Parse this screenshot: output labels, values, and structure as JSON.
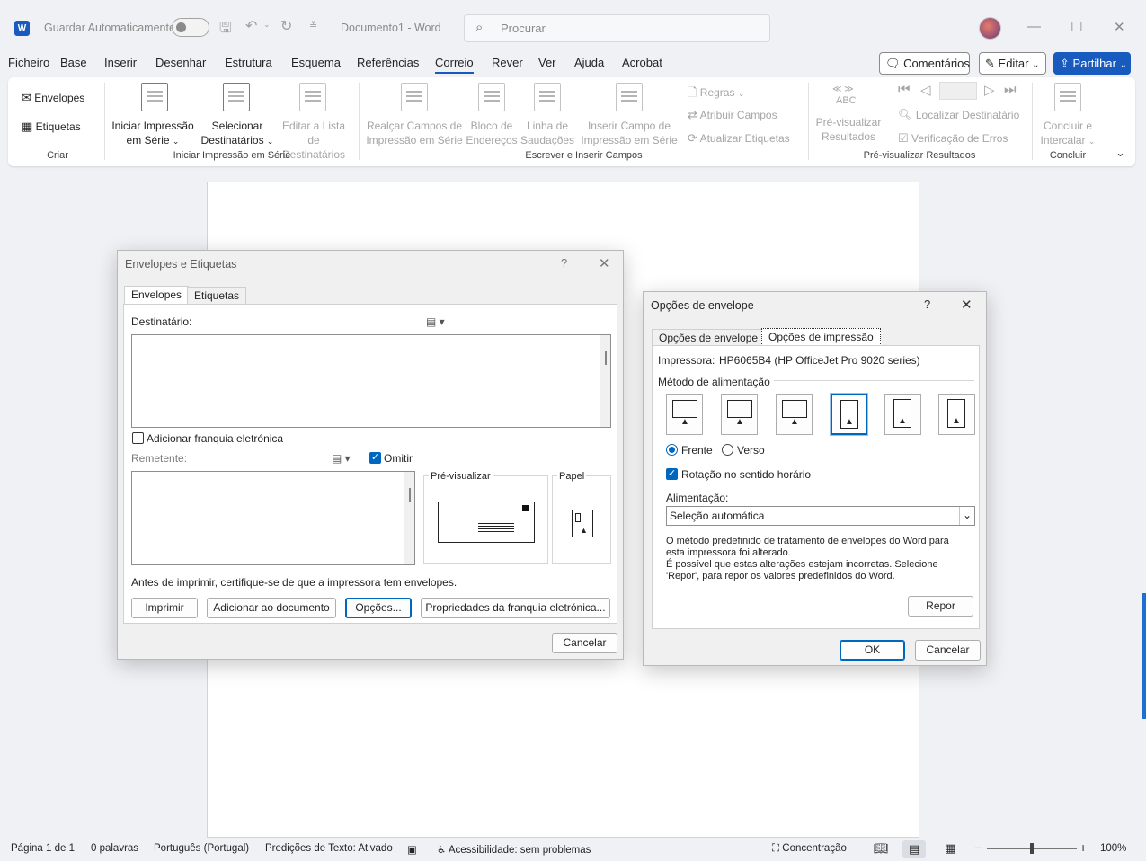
{
  "titlebar": {
    "autosave_label": "Guardar Automaticamente",
    "doc_title": "Documento1  -  Word",
    "search_placeholder": "Procurar",
    "app_logo_letter": "W"
  },
  "menu": {
    "items": [
      "Ficheiro",
      "Base",
      "Inserir",
      "Desenhar",
      "Estrutura",
      "Esquema",
      "Referências",
      "Correio",
      "Rever",
      "Ver",
      "Ajuda",
      "Acrobat"
    ],
    "active": "Correio",
    "comments_label": "Comentários",
    "edit_label": "Editar",
    "share_label": "Partilhar"
  },
  "ribbon": {
    "criar": {
      "label": "Criar",
      "envelopes": "Envelopes",
      "etiquetas": "Etiquetas"
    },
    "iniciar": {
      "label": "Iniciar Impressão em Série",
      "iniciar_l1": "Iniciar Impressão",
      "iniciar_l2": "em Série",
      "selecionar_l1": "Selecionar",
      "selecionar_l2": "Destinatários",
      "editar_l1": "Editar a Lista de",
      "editar_l2": "Destinatários"
    },
    "escrever": {
      "label": "Escrever e Inserir Campos",
      "realcar_l1": "Realçar Campos de",
      "realcar_l2": "Impressão em Série",
      "bloco_l1": "Bloco de",
      "bloco_l2": "Endereços",
      "linha_l1": "Linha de",
      "linha_l2": "Saudações",
      "inserir_l1": "Inserir Campo de",
      "inserir_l2": "Impressão em Série",
      "regras": "Regras",
      "atribuir": "Atribuir Campos",
      "atualizar": "Atualizar Etiquetas"
    },
    "previsualizar": {
      "label": "Pré-visualizar Resultados",
      "abc": "ABC",
      "btn_l1": "Pré-visualizar",
      "btn_l2": "Resultados",
      "localizar": "Localizar Destinatário",
      "verificacao": "Verificação de Erros"
    },
    "concluir": {
      "label": "Concluir",
      "btn_l1": "Concluir e",
      "btn_l2": "Intercalar"
    }
  },
  "envelopes_dialog": {
    "title": "Envelopes e Etiquetas",
    "help": "?",
    "tabs": [
      "Envelopes",
      "Etiquetas"
    ],
    "destinatario_label": "Destinatário:",
    "franquia_checkbox": "Adicionar franquia eletrónica",
    "remetente_label": "Remetente:",
    "omitir_label": "Omitir",
    "preview_label": "Pré-visualizar",
    "paper_label": "Papel",
    "notice": "Antes de imprimir, certifique-se de que a impressora tem envelopes.",
    "buttons": {
      "imprimir": "Imprimir",
      "adicionar": "Adicionar ao documento",
      "opcoes": "Opções...",
      "propriedades": "Propriedades da franquia eletrónica...",
      "cancelar": "Cancelar"
    }
  },
  "options_dialog": {
    "title": "Opções de envelope",
    "help": "?",
    "tabs": [
      "Opções de envelope",
      "Opções de impressão"
    ],
    "printer_label": "Impressora:",
    "printer_name": "HP6065B4 (HP OfficeJet Pro 9020 series)",
    "feed_method_label": "Método de alimentação",
    "feed_selected_index": 3,
    "frente": "Frente",
    "verso": "Verso",
    "rotacao": "Rotação no sentido horário",
    "alimentacao_label": "Alimentação:",
    "alimentacao_value": "Seleção automática",
    "message_l1": "O método predefinido de tratamento de envelopes do Word para",
    "message_l2": "esta impressora foi alterado.",
    "message_l3": "É possível que estas alterações estejam incorretas. Selecione",
    "message_l4": "'Repor', para repor os valores predefinidos do Word.",
    "repor": "Repor",
    "ok": "OK",
    "cancelar": "Cancelar"
  },
  "statusbar": {
    "page": "Página 1 de 1",
    "words": "0 palavras",
    "language": "Português (Portugal)",
    "predictions": "Predições de Texto: Ativado",
    "accessibility": "Acessibilidade: sem problemas",
    "focus": "Concentração",
    "zoom": "100%",
    "zoom_level": 0.5
  }
}
